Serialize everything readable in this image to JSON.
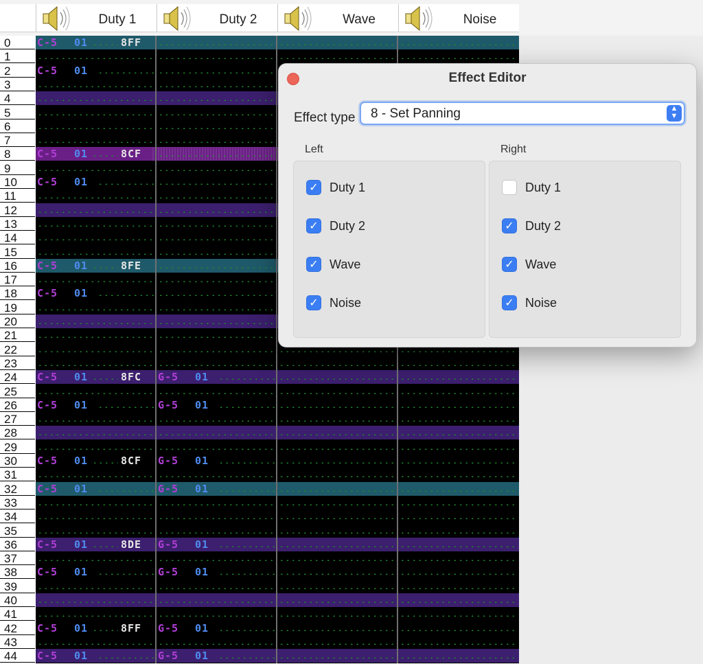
{
  "header": {
    "channels": [
      {
        "label": "Duty 1",
        "icon": "speaker-icon"
      },
      {
        "label": "Duty 2",
        "icon": "speaker-icon"
      },
      {
        "label": "Wave",
        "icon": "speaker-icon"
      },
      {
        "label": "Noise",
        "icon": "speaker-icon"
      }
    ]
  },
  "colors": {
    "highlight_teal": "#1f5a6a",
    "highlight_purple": "#3c1f6e",
    "selected_row": "#6a1f86",
    "note": "#b13fd6",
    "instrument": "#4f8cf0",
    "effect": "#e8e8e8",
    "dots": "#1e8a2e"
  },
  "rows": [
    "0",
    "1",
    "2",
    "3",
    "4",
    "5",
    "6",
    "7",
    "8",
    "9",
    "10",
    "11",
    "12",
    "13",
    "14",
    "15",
    "16",
    "17",
    "18",
    "19",
    "20",
    "21",
    "22",
    "23",
    "24",
    "25",
    "26",
    "27",
    "28",
    "29",
    "30",
    "31",
    "32",
    "33",
    "34",
    "35",
    "36",
    "37",
    "38",
    "39",
    "40",
    "41",
    "42",
    "43",
    "44"
  ],
  "pattern": [
    {
      "row": 0,
      "ch": 0,
      "note": "C-5",
      "inst": "01",
      "eff": "8FF"
    },
    {
      "row": 2,
      "ch": 0,
      "note": "C-5",
      "inst": "01",
      "eff": ""
    },
    {
      "row": 8,
      "ch": 0,
      "note": "C-5",
      "inst": "01",
      "eff": "8CF"
    },
    {
      "row": 10,
      "ch": 0,
      "note": "C-5",
      "inst": "01",
      "eff": ""
    },
    {
      "row": 16,
      "ch": 0,
      "note": "C-5",
      "inst": "01",
      "eff": "8FE"
    },
    {
      "row": 18,
      "ch": 0,
      "note": "C-5",
      "inst": "01",
      "eff": ""
    },
    {
      "row": 24,
      "ch": 0,
      "note": "C-5",
      "inst": "01",
      "eff": "8FC"
    },
    {
      "row": 24,
      "ch": 1,
      "note": "G-5",
      "inst": "01",
      "eff": ""
    },
    {
      "row": 26,
      "ch": 0,
      "note": "C-5",
      "inst": "01",
      "eff": ""
    },
    {
      "row": 26,
      "ch": 1,
      "note": "G-5",
      "inst": "01",
      "eff": ""
    },
    {
      "row": 30,
      "ch": 0,
      "note": "C-5",
      "inst": "01",
      "eff": "8CF"
    },
    {
      "row": 30,
      "ch": 1,
      "note": "G-5",
      "inst": "01",
      "eff": ""
    },
    {
      "row": 32,
      "ch": 0,
      "note": "C-5",
      "inst": "01",
      "eff": ""
    },
    {
      "row": 32,
      "ch": 1,
      "note": "G-5",
      "inst": "01",
      "eff": ""
    },
    {
      "row": 36,
      "ch": 0,
      "note": "C-5",
      "inst": "01",
      "eff": "8DE"
    },
    {
      "row": 36,
      "ch": 1,
      "note": "G-5",
      "inst": "01",
      "eff": ""
    },
    {
      "row": 38,
      "ch": 0,
      "note": "C-5",
      "inst": "01",
      "eff": ""
    },
    {
      "row": 38,
      "ch": 1,
      "note": "G-5",
      "inst": "01",
      "eff": ""
    },
    {
      "row": 42,
      "ch": 0,
      "note": "C-5",
      "inst": "01",
      "eff": "8FF"
    },
    {
      "row": 42,
      "ch": 1,
      "note": "G-5",
      "inst": "01",
      "eff": ""
    },
    {
      "row": 44,
      "ch": 0,
      "note": "C-5",
      "inst": "01",
      "eff": ""
    },
    {
      "row": 44,
      "ch": 1,
      "note": "G-5",
      "inst": "01",
      "eff": ""
    }
  ],
  "highlights": {
    "teal_every": 16,
    "purple_every": 4
  },
  "selected_row": 8,
  "dialog": {
    "title": "Effect Editor",
    "effect_type_label": "Effect type",
    "effect_type_value": "8 - Set Panning",
    "left_label": "Left",
    "right_label": "Right",
    "left": [
      {
        "label": "Duty 1",
        "checked": true
      },
      {
        "label": "Duty 2",
        "checked": true
      },
      {
        "label": "Wave",
        "checked": true
      },
      {
        "label": "Noise",
        "checked": true
      }
    ],
    "right": [
      {
        "label": "Duty 1",
        "checked": false
      },
      {
        "label": "Duty 2",
        "checked": true
      },
      {
        "label": "Wave",
        "checked": true
      },
      {
        "label": "Noise",
        "checked": true
      }
    ]
  }
}
